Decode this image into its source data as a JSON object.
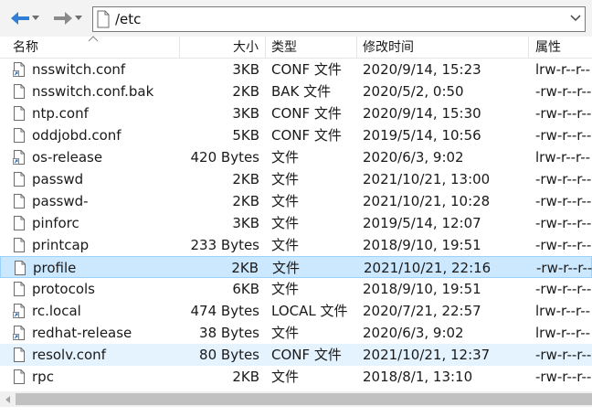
{
  "toolbar": {
    "back_icon": "back-arrow-icon",
    "forward_icon": "forward-arrow-icon",
    "path": "/etc",
    "accent": "#1a73c8"
  },
  "columns": {
    "name": "名称",
    "size": "大小",
    "type": "类型",
    "modified": "修改时间",
    "attributes": "属性"
  },
  "files": [
    {
      "name": "nsswitch.conf",
      "size": "3KB",
      "type": "CONF 文件",
      "modified": "2020/9/14, 15:23",
      "attr": "lrw-r--r--",
      "icon": "link-file-icon"
    },
    {
      "name": "nsswitch.conf.bak",
      "size": "2KB",
      "type": "BAK 文件",
      "modified": "2020/5/2, 0:50",
      "attr": "-rw-r--r--",
      "icon": "file-icon"
    },
    {
      "name": "ntp.conf",
      "size": "3KB",
      "type": "CONF 文件",
      "modified": "2020/9/14, 15:30",
      "attr": "-rw-r--r--",
      "icon": "file-icon"
    },
    {
      "name": "oddjobd.conf",
      "size": "5KB",
      "type": "CONF 文件",
      "modified": "2019/5/14, 10:56",
      "attr": "-rw-r--r--",
      "icon": "file-icon"
    },
    {
      "name": "os-release",
      "size": "420 Bytes",
      "type": "文件",
      "modified": "2020/6/3, 9:02",
      "attr": "lrw-r--r--",
      "icon": "link-file-icon"
    },
    {
      "name": "passwd",
      "size": "2KB",
      "type": "文件",
      "modified": "2021/10/21, 13:00",
      "attr": "-rw-r--r--",
      "icon": "file-icon"
    },
    {
      "name": "passwd-",
      "size": "2KB",
      "type": "文件",
      "modified": "2021/10/21, 10:28",
      "attr": "-rw-r--r--",
      "icon": "file-icon"
    },
    {
      "name": "pinforc",
      "size": "3KB",
      "type": "文件",
      "modified": "2019/5/14, 12:07",
      "attr": "-rw-r--r--",
      "icon": "file-icon"
    },
    {
      "name": "printcap",
      "size": "233 Bytes",
      "type": "文件",
      "modified": "2018/9/10, 19:51",
      "attr": "-rw-r--r--",
      "icon": "file-icon"
    },
    {
      "name": "profile",
      "size": "2KB",
      "type": "文件",
      "modified": "2021/10/21, 22:16",
      "attr": "-rw-r--r--",
      "icon": "file-icon",
      "state": "selected"
    },
    {
      "name": "protocols",
      "size": "6KB",
      "type": "文件",
      "modified": "2018/9/10, 19:51",
      "attr": "-rw-r--r--",
      "icon": "file-icon"
    },
    {
      "name": "rc.local",
      "size": "474 Bytes",
      "type": "LOCAL 文件",
      "modified": "2020/7/21, 22:57",
      "attr": "lrw-r--r--",
      "icon": "link-file-icon"
    },
    {
      "name": "redhat-release",
      "size": "38 Bytes",
      "type": "文件",
      "modified": "2020/6/3, 9:02",
      "attr": "lrw-r--r--",
      "icon": "link-file-icon"
    },
    {
      "name": "resolv.conf",
      "size": "80 Bytes",
      "type": "CONF 文件",
      "modified": "2021/10/21, 12:37",
      "attr": "-rw-r--r--",
      "icon": "file-icon",
      "state": "hover"
    },
    {
      "name": "rpc",
      "size": "2KB",
      "type": "文件",
      "modified": "2018/8/1, 13:10",
      "attr": "-rw-r--r--",
      "icon": "file-icon"
    }
  ]
}
